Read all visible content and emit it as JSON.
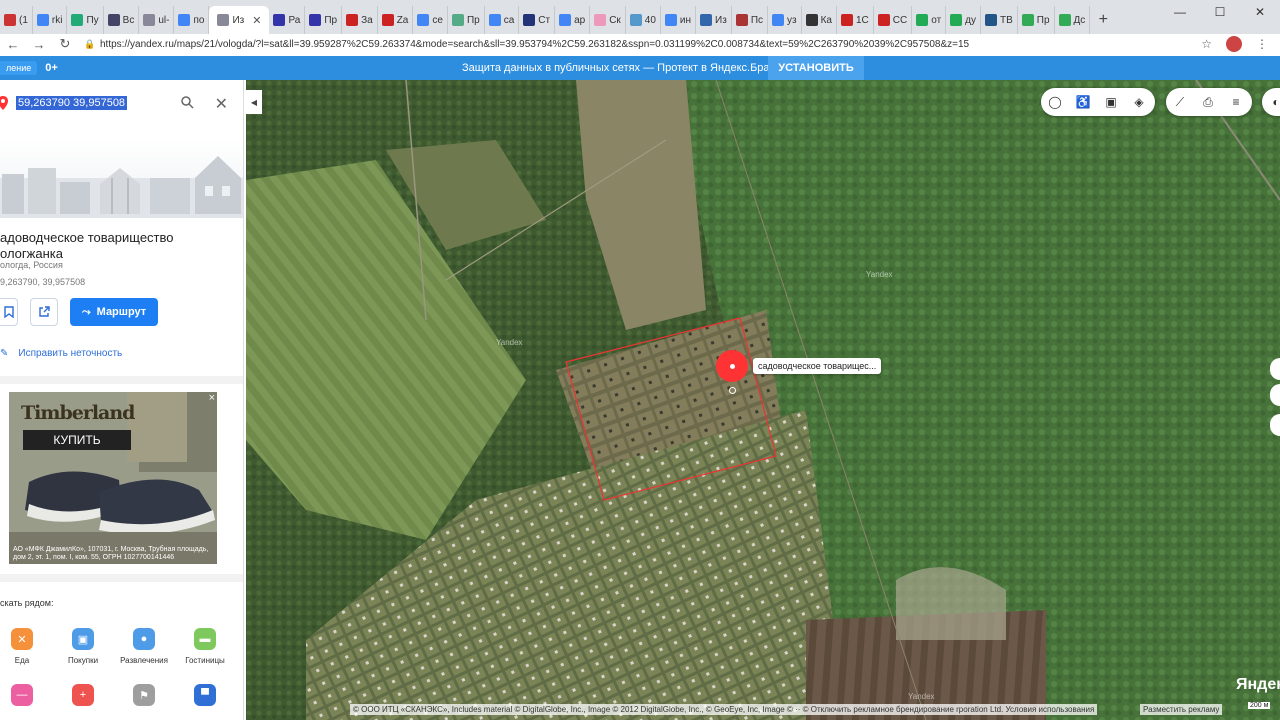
{
  "browser": {
    "tabs": [
      {
        "label": "(1",
        "color": "#c33"
      },
      {
        "label": "rki",
        "color": "#4285f4"
      },
      {
        "label": "Пу",
        "color": "#2a7"
      },
      {
        "label": "Вс",
        "color": "#446"
      },
      {
        "label": "ul-",
        "color": "#889"
      },
      {
        "label": "по",
        "color": "#4285f4"
      },
      {
        "label": "Из",
        "color": "#889"
      },
      {
        "label": "Ра",
        "color": "#33a"
      },
      {
        "label": "Пр",
        "color": "#33a"
      },
      {
        "label": "За",
        "color": "#c22"
      },
      {
        "label": "Za",
        "color": "#c22"
      },
      {
        "label": "се",
        "color": "#4285f4"
      },
      {
        "label": "Пр",
        "color": "#5a8"
      },
      {
        "label": "са",
        "color": "#4285f4"
      },
      {
        "label": "Ст",
        "color": "#237"
      },
      {
        "label": "ар",
        "color": "#4285f4"
      },
      {
        "label": "Ск",
        "color": "#e9b"
      },
      {
        "label": "40",
        "color": "#59c"
      },
      {
        "label": "ин",
        "color": "#4285f4"
      },
      {
        "label": "Из",
        "color": "#36a"
      },
      {
        "label": "Пс",
        "color": "#a33"
      },
      {
        "label": "уз",
        "color": "#4285f4"
      },
      {
        "label": "Ка",
        "color": "#333"
      },
      {
        "label": "1С",
        "color": "#c22"
      },
      {
        "label": "СС",
        "color": "#c22"
      },
      {
        "label": "от",
        "color": "#2a5"
      },
      {
        "label": "ду",
        "color": "#2a5"
      },
      {
        "label": "ТВ",
        "color": "#258"
      },
      {
        "label": "Пр",
        "color": "#3a5"
      },
      {
        "label": "Дс",
        "color": "#3a5"
      }
    ],
    "active_tab_index": 6,
    "url": "https://yandex.ru/maps/21/vologda/?l=sat&ll=39.959287%2C59.263374&mode=search&sll=39.953794%2C59.263182&sspn=0.031199%2C0.008734&text=59%2C263790%2039%2C957508&z=15"
  },
  "promo": {
    "badge": "ление",
    "age": "0+",
    "message": "Защита данных в публичных сетях — Протект в Яндекс.Браузере",
    "install_label": "УСТАНОВИТЬ"
  },
  "sidebar": {
    "query": "59,263790 39,957508",
    "place_title": "адоводческое товарищество ологжанка",
    "place_subtitle": "ологда, Россия",
    "place_coords": "9,263790, 39,957508",
    "route_label": "Маршрут",
    "fix_label": "Исправить неточность",
    "ad": {
      "brand": "Timberland",
      "buy_label": "КУПИТЬ",
      "close": "×",
      "legal": "АО «МФК ДжамилКо», 107031, г. Москва, Трубная площадь, дом 2, эт. 1, пом. I, ком. 55, ОГРН 1027700141446"
    },
    "nearby_label": "скать рядом:",
    "categories": [
      {
        "label": "Еда",
        "color": "#f5913a",
        "glyph": "✕"
      },
      {
        "label": "Покупки",
        "color": "#4e9be8",
        "glyph": "▣"
      },
      {
        "label": "Развлечения",
        "color": "#4e9be8",
        "glyph": "●"
      },
      {
        "label": "Гостиницы",
        "color": "#7dc95e",
        "glyph": "▬"
      },
      {
        "label": "",
        "color": "#ec5fa0",
        "glyph": "—"
      },
      {
        "label": "",
        "color": "#ef5350",
        "glyph": "+"
      },
      {
        "label": "",
        "color": "#9e9e9e",
        "glyph": "⚑"
      },
      {
        "label": "",
        "color": "#2f6fd6",
        "glyph": "▀"
      }
    ]
  },
  "map": {
    "pin_label": "садоводческое товарищес...",
    "watermark": "Yandex",
    "copyright": "© ООО ИТЦ «СКАНЭКС», Includes material © DigitalGlobe, Inc., Image © 2012 DigitalGlobe, Inc., © GeoEye, Inc, Image © ·· © Отключить рекламное брендирование rporation Ltd. Условия использования",
    "place_ad_label": "Разместить рекламу",
    "scale": "200 м",
    "logo": "Яндекс"
  }
}
